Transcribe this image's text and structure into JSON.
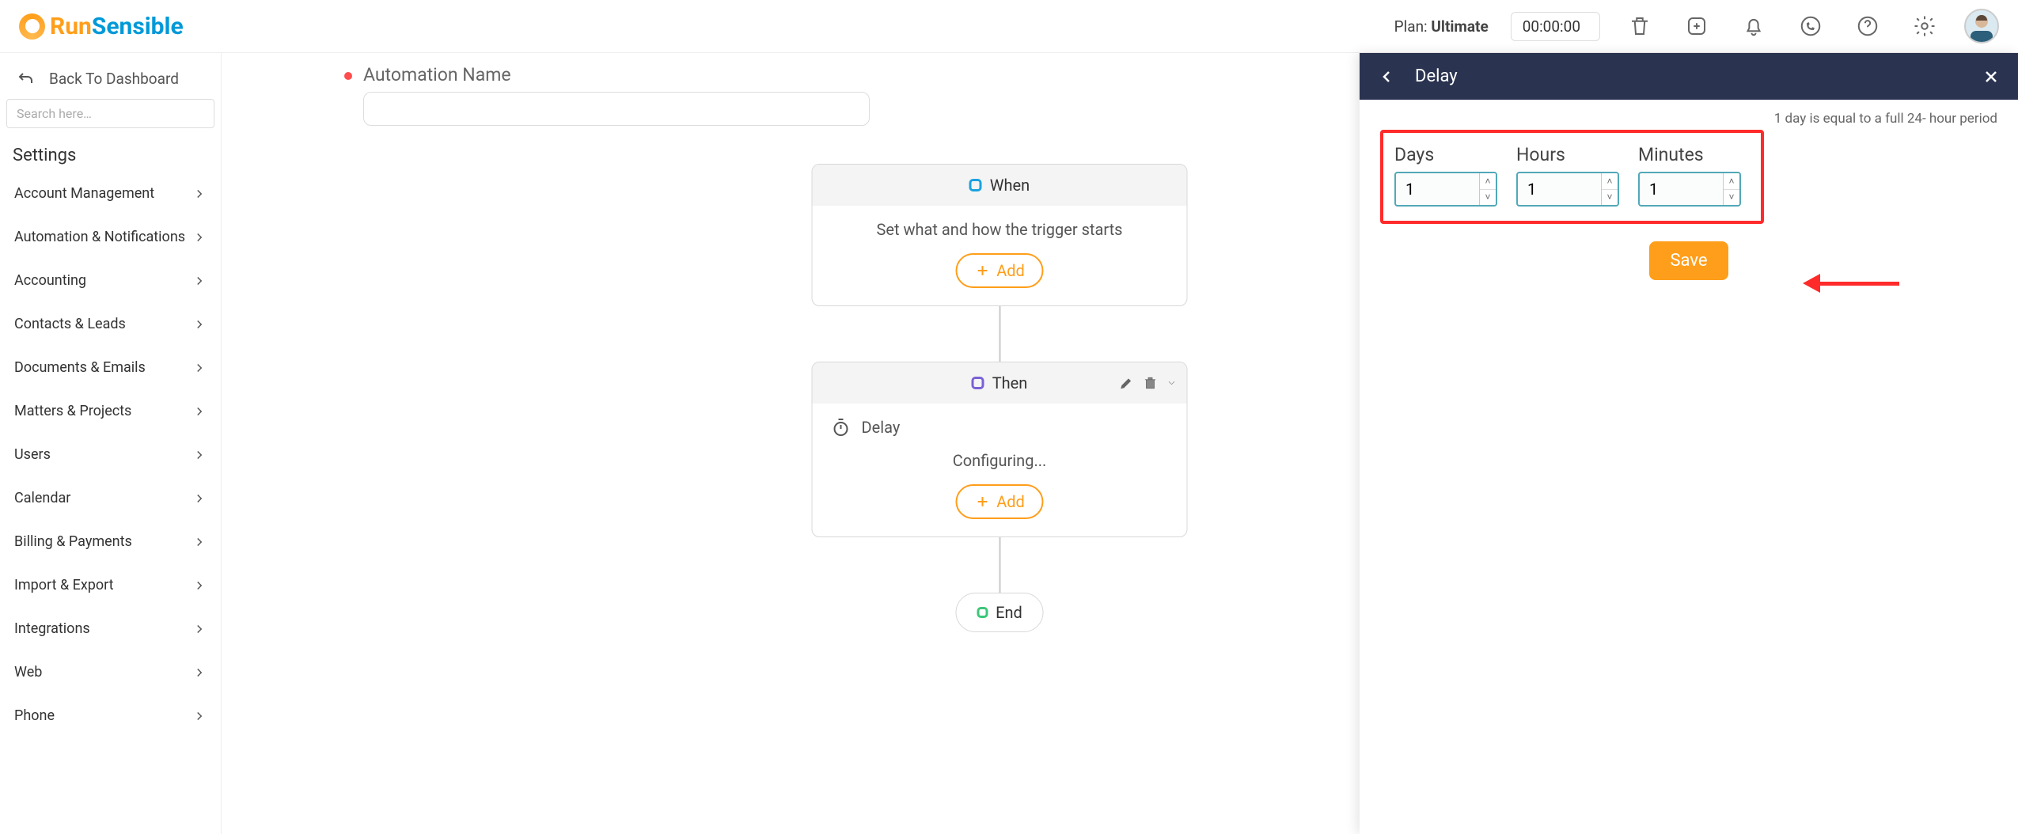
{
  "brand": {
    "part1": "Run",
    "part2": "Sensible"
  },
  "header": {
    "plan_prefix": "Plan:",
    "plan_name": "Ultimate",
    "timer": "00:00:00"
  },
  "sidebar": {
    "back_label": "Back To Dashboard",
    "search_placeholder": "Search here…",
    "section": "Settings",
    "items": [
      {
        "label": "Account Management"
      },
      {
        "label": "Automation & Notifications"
      },
      {
        "label": "Accounting"
      },
      {
        "label": "Contacts & Leads"
      },
      {
        "label": "Documents & Emails"
      },
      {
        "label": "Matters & Projects"
      },
      {
        "label": "Users"
      },
      {
        "label": "Calendar"
      },
      {
        "label": "Billing & Payments"
      },
      {
        "label": "Import & Export"
      },
      {
        "label": "Integrations"
      },
      {
        "label": "Web"
      },
      {
        "label": "Phone"
      }
    ]
  },
  "canvas": {
    "name_label": "Automation Name",
    "name_value": "",
    "when": {
      "title": "When",
      "body": "Set what and how the trigger starts",
      "add": "Add"
    },
    "then": {
      "title": "Then",
      "action_label": "Delay",
      "status": "Configuring...",
      "add": "Add"
    },
    "end": {
      "title": "End"
    }
  },
  "panel": {
    "title": "Delay",
    "hint": "1 day is equal to a full 24- hour period",
    "days_label": "Days",
    "hours_label": "Hours",
    "minutes_label": "Minutes",
    "days_value": "1",
    "hours_value": "1",
    "minutes_value": "1",
    "save": "Save"
  }
}
